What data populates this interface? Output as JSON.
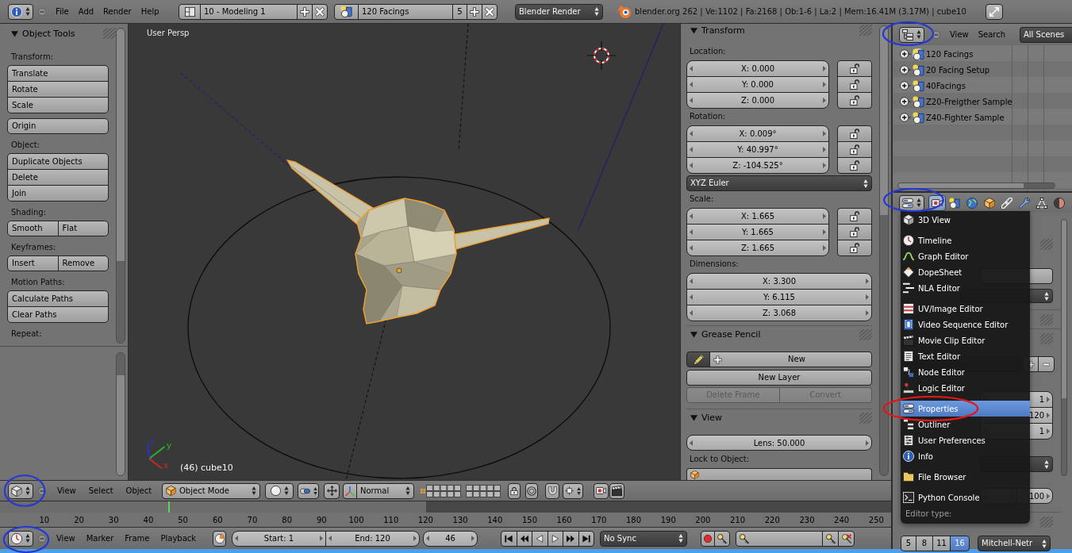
{
  "info_header": {
    "editor_type": {
      "circled": false
    },
    "menus": [
      "File",
      "Add",
      "Render",
      "Help"
    ],
    "screen_layout": "10 - Modeling 1",
    "scene": "120 Facings",
    "scene_users": "5",
    "render_engine": "Blender Render",
    "stats": "blender.org 262 | Ve:1102 | Fa:2168 | Ob:1-6 | La:2 | Mem:16.41M (3.17M) | cube10"
  },
  "tool_shelf": {
    "title": "Object Tools",
    "expanded": true,
    "groups": [
      {
        "label": "Transform:",
        "blocks": [
          [
            [
              "Translate"
            ],
            [
              "Rotate"
            ],
            [
              "Scale"
            ]
          ],
          [
            [
              "Origin"
            ]
          ]
        ]
      },
      {
        "label": "Object:",
        "blocks": [
          [
            [
              "Duplicate Objects"
            ],
            [
              "Delete"
            ],
            [
              "Join"
            ]
          ]
        ]
      },
      {
        "label": "Shading:",
        "blocks": [
          [
            [
              "Smooth",
              "Flat"
            ]
          ]
        ]
      },
      {
        "label": "Keyframes:",
        "blocks": [
          [
            [
              "Insert",
              "Remove"
            ]
          ]
        ]
      },
      {
        "label": "Motion Paths:",
        "blocks": [
          [
            [
              "Calculate Paths"
            ],
            [
              "Clear Paths"
            ]
          ]
        ]
      },
      {
        "label": "Repeat:"
      }
    ]
  },
  "viewport": {
    "view_name": "User Persp",
    "object_info": "(46) cube10",
    "axes": [
      {
        "label": "x",
        "color": "#c82828"
      },
      {
        "label": "y",
        "color": "#28b428"
      },
      {
        "label": "z",
        "color": "#2f2fd0"
      }
    ]
  },
  "sidebar": {
    "transform": {
      "title": "Transform",
      "expanded": true,
      "items": [
        {
          "kind": "vector",
          "label": "Location:",
          "fields": [
            {
              "value": "X: 0.000",
              "locked": false
            },
            {
              "value": "Y: 0.000",
              "locked": false
            },
            {
              "value": "Z: 0.000",
              "locked": false
            }
          ]
        },
        {
          "kind": "vector",
          "label": "Rotation:",
          "fields": [
            {
              "value": "X: 0.009°",
              "locked": false
            },
            {
              "value": "Y: 40.997°",
              "locked": false
            },
            {
              "value": "Z: -104.525°",
              "locked": false
            }
          ]
        },
        {
          "kind": "dropdown",
          "value": "XYZ Euler"
        },
        {
          "kind": "vector",
          "label": "Scale:",
          "fields": [
            {
              "value": "X: 1.665",
              "locked": false
            },
            {
              "value": "Y: 1.665",
              "locked": false
            },
            {
              "value": "Z: 1.665",
              "locked": false
            }
          ]
        },
        {
          "kind": "vector",
          "label": "Dimensions:",
          "fields": [
            {
              "value": "X: 3.300"
            },
            {
              "value": "Y: 6.115"
            },
            {
              "value": "Z: 3.068"
            }
          ]
        }
      ]
    },
    "grease_pencil": {
      "title": "Grease Pencil",
      "expanded": true,
      "draw_on": true,
      "new": "New",
      "new_layer": "New Layer",
      "actions": [
        {
          "label": "Delete Frame",
          "disabled": true
        },
        {
          "label": "Convert",
          "disabled": true
        }
      ]
    },
    "view": {
      "title": "View",
      "expanded": true,
      "lens": "Lens: 50.000",
      "lock_label": "Lock to Object:"
    }
  },
  "outliner": {
    "editor_type": {
      "circled": true
    },
    "menus": [
      "View",
      "Search"
    ],
    "display_mode": "All Scenes",
    "rows": [
      {
        "label": "120 Facings",
        "expanded": false,
        "active": true
      },
      {
        "label": "20 Facing Setup",
        "expanded": false,
        "active": false
      },
      {
        "label": "40Facings",
        "expanded": false,
        "active": false
      },
      {
        "label": "Z20-Freigther Sample",
        "expanded": false,
        "active": false
      },
      {
        "label": "Z40-Fighter Sample",
        "expanded": false,
        "active": false
      }
    ]
  },
  "properties": {
    "editor_type": {
      "circled": true
    },
    "tabs": [
      {
        "selected": true
      },
      {
        "selected": false
      },
      {
        "selected": false
      },
      {
        "selected": false
      },
      {
        "selected": false
      },
      {
        "selected": false
      },
      {
        "selected": false
      },
      {
        "selected": false
      }
    ],
    "frame_range": [
      "1",
      "120",
      "1"
    ],
    "time_remap": "100",
    "samples": [
      {
        "label": "5",
        "selected": false
      },
      {
        "label": "8",
        "selected": false
      },
      {
        "label": "11",
        "selected": false
      },
      {
        "label": "16",
        "selected": true
      }
    ],
    "filter": "Mitchell-Netr"
  },
  "editor_menu": {
    "sections": [
      [
        {
          "label": "3D View",
          "selected": false,
          "circled": false
        }
      ],
      [
        {
          "label": "Timeline",
          "selected": false,
          "circled": false
        },
        {
          "label": "Graph Editor",
          "selected": false,
          "circled": false
        },
        {
          "label": "DopeSheet",
          "selected": false,
          "circled": false
        },
        {
          "label": "NLA Editor",
          "selected": false,
          "circled": false
        }
      ],
      [
        {
          "label": "UV/Image Editor",
          "selected": false,
          "circled": false
        },
        {
          "label": "Video Sequence Editor",
          "selected": false,
          "circled": false
        },
        {
          "label": "Movie Clip Editor",
          "selected": false,
          "circled": false
        },
        {
          "label": "Text Editor",
          "selected": false,
          "circled": false
        },
        {
          "label": "Node Editor",
          "selected": false,
          "circled": false
        },
        {
          "label": "Logic Editor",
          "selected": false,
          "circled": false
        }
      ],
      [
        {
          "label": "Properties",
          "selected": true,
          "circled": true
        },
        {
          "label": "Outliner",
          "selected": false,
          "circled": false
        },
        {
          "label": "User Preferences",
          "selected": false,
          "circled": false
        },
        {
          "label": "Info",
          "selected": false,
          "circled": false
        }
      ],
      [
        {
          "label": "File Browser",
          "selected": false,
          "circled": false
        }
      ],
      [
        {
          "label": "Python Console",
          "selected": false,
          "circled": false
        }
      ]
    ],
    "title": "Editor type:"
  },
  "view3d_header": {
    "editor_type": {
      "circled": true
    },
    "menus": [
      "View",
      "Select",
      "Object"
    ],
    "mode": "Object Mode",
    "orientation": "Normal"
  },
  "timeline": {
    "frame_labels": [
      "10",
      "20",
      "30",
      "40",
      "50",
      "60",
      "70",
      "80",
      "90",
      "100",
      "110",
      "120",
      "130",
      "140",
      "150",
      "160",
      "170",
      "180",
      "190",
      "200",
      "210",
      "220",
      "230",
      "240",
      "250"
    ],
    "frame_range": {
      "level": 0.478
    },
    "playhead": {
      "level": 0.19
    }
  },
  "timeline_header": {
    "editor_type": {
      "circled": true
    },
    "menus": [
      "View",
      "Marker",
      "Frame",
      "Playback"
    ],
    "start": "Start: 1",
    "end": "End: 120",
    "current_frame": "46",
    "sync": "No Sync"
  }
}
